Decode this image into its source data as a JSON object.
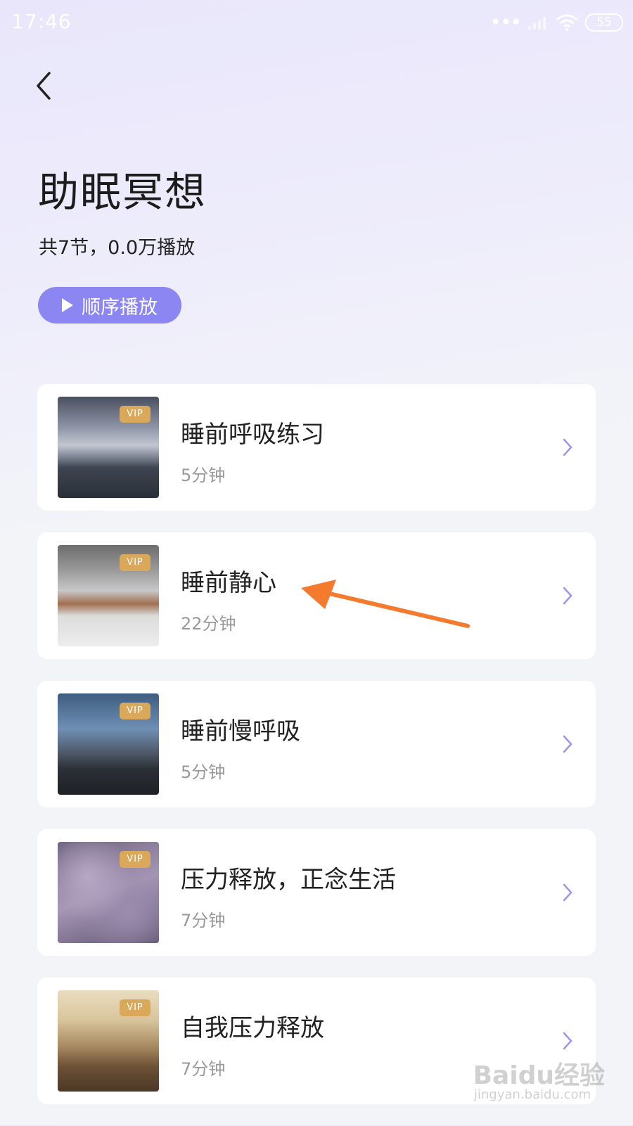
{
  "status_bar": {
    "time": "17:46",
    "battery": "55"
  },
  "header": {
    "title": "助眠冥想",
    "subtitle": "共7节，0.0万播放",
    "play_button_label": "顺序播放"
  },
  "items": [
    {
      "title": "睡前呼吸练习",
      "duration": "5分钟",
      "badge": "VIP"
    },
    {
      "title": "睡前静心",
      "duration": "22分钟",
      "badge": "VIP"
    },
    {
      "title": "睡前慢呼吸",
      "duration": "5分钟",
      "badge": "VIP"
    },
    {
      "title": "压力释放，正念生活",
      "duration": "7分钟",
      "badge": "VIP"
    },
    {
      "title": "自我压力释放",
      "duration": "7分钟",
      "badge": "VIP"
    }
  ],
  "watermark": {
    "brand": "Baidu经验",
    "url": "jingyan.baidu.com"
  },
  "colors": {
    "accent": "#8c86f3",
    "vip_badge": "#d9a85a",
    "chevron": "#9b96e8",
    "annotation_arrow": "#f47a2e"
  },
  "icons": {
    "back": "chevron-left-icon",
    "play": "play-icon",
    "row_arrow": "chevron-right-icon"
  }
}
